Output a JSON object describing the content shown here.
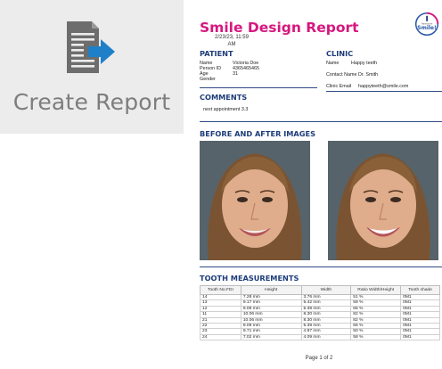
{
  "tile": {
    "label": "Create Report",
    "icon": "create-report-icon",
    "colors": {
      "background": "#ececec",
      "document": "#6d6d6d",
      "arrow": "#1f80c9"
    }
  },
  "report": {
    "title": "Smile Design Report",
    "date_line1": "2/23/23, 11:59",
    "date_line2": "AM",
    "logo": {
      "small_text": "Harmonize",
      "brand": "Smile!"
    },
    "patient": {
      "heading": "PATIENT",
      "fields": [
        {
          "label": "Name",
          "value": "Victoria Doe"
        },
        {
          "label": "Person ID",
          "value": "4365465465"
        },
        {
          "label": "Age",
          "value": "31"
        },
        {
          "label": "Gender",
          "value": ""
        }
      ]
    },
    "clinic": {
      "heading": "CLINIC",
      "fields": [
        {
          "label": "Name",
          "value": "Happy teeth"
        },
        {
          "label": "Contact Name",
          "value": "Dr. Smith"
        },
        {
          "label": "Clinic Email",
          "value": "happyteeth@smile.com"
        }
      ]
    },
    "comments": {
      "heading": "COMMENTS",
      "text": "next appointment 3.3"
    },
    "images": {
      "heading": "BEFORE AND AFTER IMAGES"
    },
    "measurements": {
      "heading": "TOOTH MEASUREMENTS",
      "columns": [
        "Tooth No.FDI",
        "Height",
        "Width",
        "Ratio Width/Height",
        "Tooth shade"
      ],
      "rows": [
        [
          "14",
          "7.28 mm",
          "3.76 mm",
          "51 %",
          "0M1"
        ],
        [
          "13",
          "9.17 mm",
          "5.42 mm",
          "59 %",
          "0M1"
        ],
        [
          "12",
          "8.09 mm",
          "5.39 mm",
          "66 %",
          "0M1"
        ],
        [
          "11",
          "10.06 mm",
          "8.30 mm",
          "82 %",
          "0M1"
        ],
        [
          "21",
          "10.06 mm",
          "8.30 mm",
          "82 %",
          "0M1"
        ],
        [
          "22",
          "8.09 mm",
          "5.39 mm",
          "66 %",
          "0M1"
        ],
        [
          "23",
          "9.71 mm",
          "4.87 mm",
          "50 %",
          "0M1"
        ],
        [
          "24",
          "7.02 mm",
          "4.09 mm",
          "58 %",
          "0M1"
        ]
      ]
    },
    "page": "Page 1 of 2",
    "colors": {
      "title": "#d6177e",
      "section": "#1d3c78",
      "rule": "#2d4b86"
    }
  }
}
